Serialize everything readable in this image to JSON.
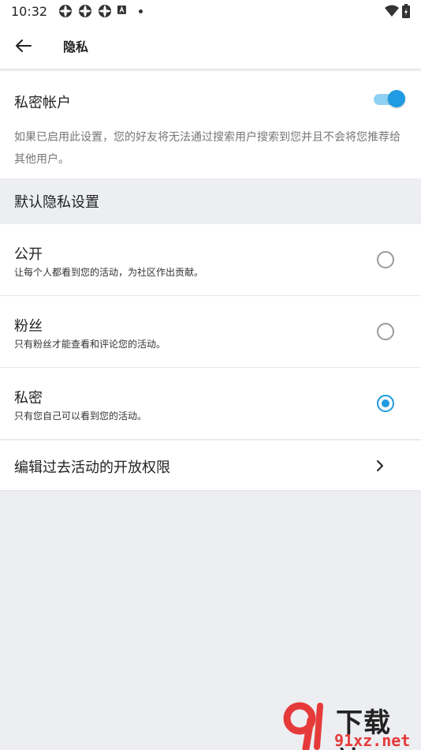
{
  "status_bar": {
    "time": "10:32",
    "icons": [
      "settings-flower-icon",
      "settings-flower-icon",
      "settings-flower-icon",
      "a-box-icon",
      "dot-icon",
      "wifi-icon",
      "battery-icon"
    ]
  },
  "app_bar": {
    "title": "隐私",
    "back_icon": "arrow-left-icon"
  },
  "private_account": {
    "title": "私密帐户",
    "enabled": true,
    "description": "如果已启用此设置，您的好友将无法通过搜索用户搜索到您并且不会将您推荐给其他用户。"
  },
  "default_privacy": {
    "header": "默认隐私设置",
    "options": [
      {
        "title": "公开",
        "subtitle": "让每个人都看到您的活动，为社区作出贡献。",
        "selected": false
      },
      {
        "title": "粉丝",
        "subtitle": "只有粉丝才能查看和评论您的活动。",
        "selected": false
      },
      {
        "title": "私密",
        "subtitle": "只有您自己可以看到您的活动。",
        "selected": true
      }
    ]
  },
  "edit_past": {
    "label": "编辑过去活动的开放权限",
    "icon": "chevron-right-icon"
  },
  "watermark": {
    "cn": "下载站",
    "en": "91xz.net"
  },
  "colors": {
    "accent": "#1e9be2",
    "accent_light": "#8fd0f0",
    "background": "#eceef1",
    "surface": "#ffffff"
  }
}
